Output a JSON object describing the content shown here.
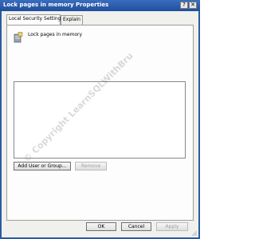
{
  "window": {
    "title": "Lock pages in memory Properties",
    "help_label": "?",
    "close_label": "✕"
  },
  "tabs": [
    {
      "label": "Local Security Setting"
    },
    {
      "label": "Explain"
    }
  ],
  "setting": {
    "name": "Lock pages in memory",
    "icon": "policy-server-icon"
  },
  "principals_list": [],
  "buttons": {
    "add": "Add User or Group...",
    "remove": "Remove",
    "ok": "OK",
    "cancel": "Cancel",
    "apply": "Apply"
  },
  "watermark": "© Copyright LearnSQLWithBru",
  "colors": {
    "titlebar": "#2b5aa3",
    "dialog_bg": "#f0f0ed"
  }
}
